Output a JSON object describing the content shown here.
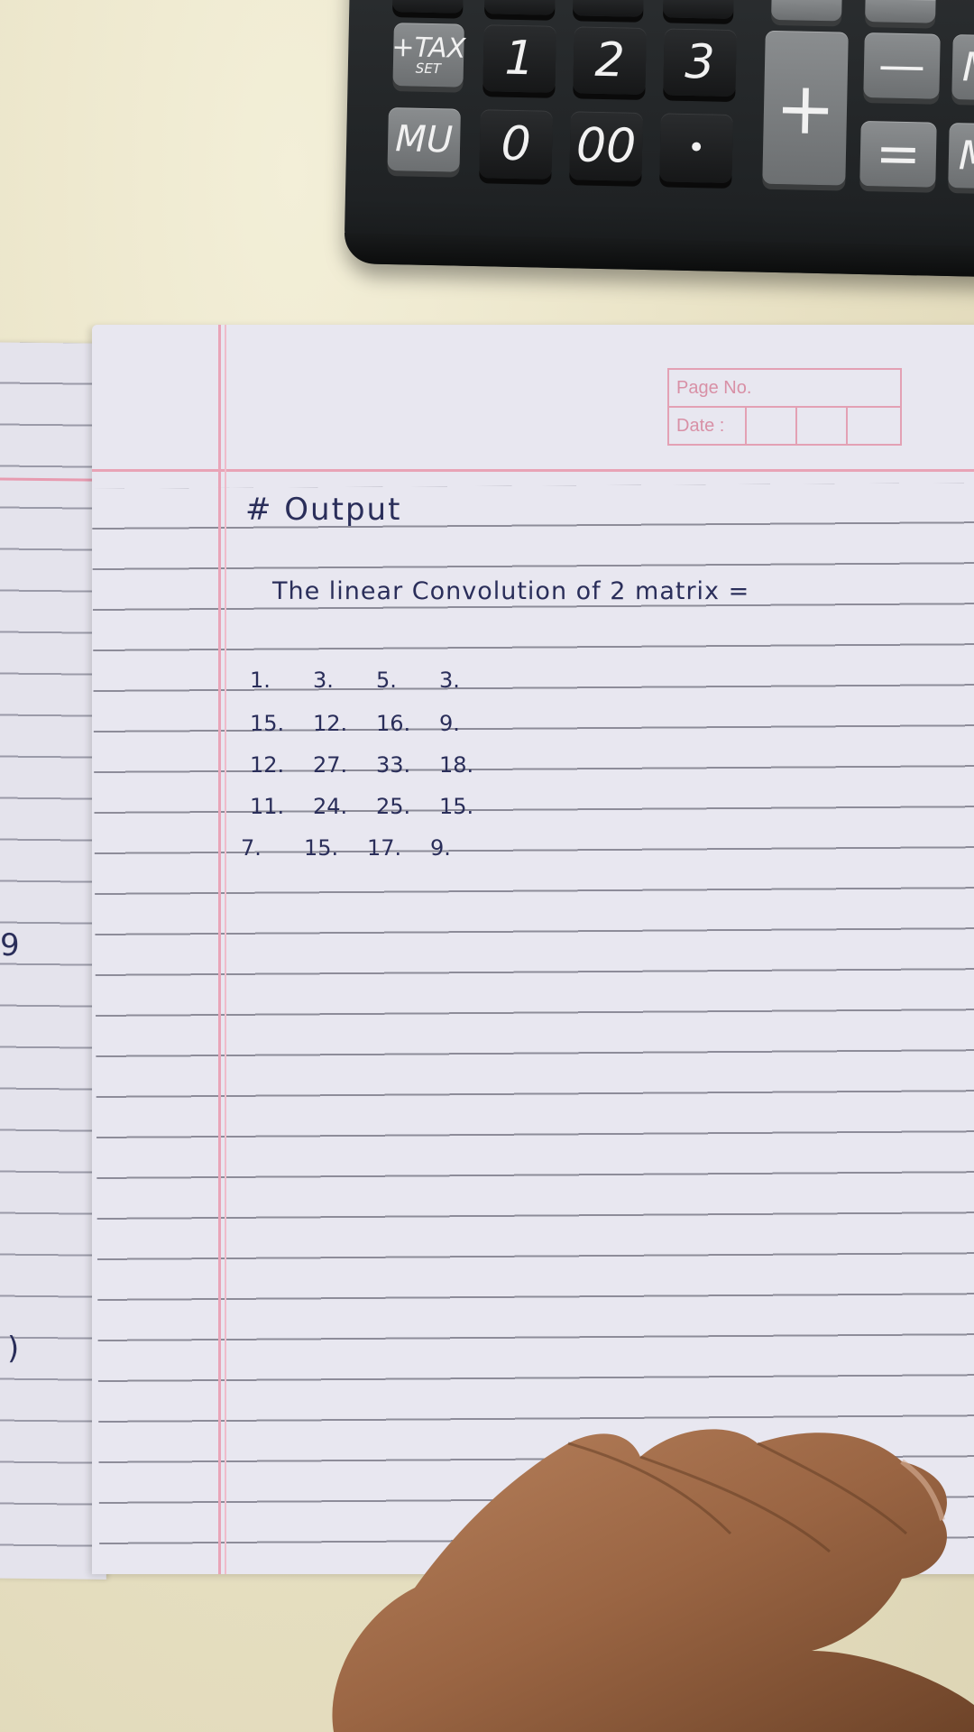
{
  "calculator": {
    "row1": [
      "+TAX",
      "1",
      "2",
      "3"
    ],
    "tax_sub": "SET",
    "row2": [
      "MU",
      "0",
      "00",
      "•"
    ],
    "plus": "+",
    "minus": "—",
    "equals": "=",
    "partial": [
      "M",
      "M"
    ]
  },
  "pagebox": {
    "page_no": "Page No.",
    "date": "Date :"
  },
  "notes": {
    "heading": "# Output",
    "sentence": "The linear Convolution of 2 matrix =",
    "matrix": [
      [
        "1.",
        "3.",
        "5.",
        "3."
      ],
      [
        "15.",
        "12.",
        "16.",
        "9."
      ],
      [
        "12.",
        "27.",
        "33.",
        "18."
      ],
      [
        "11.",
        "24.",
        "25.",
        "15."
      ],
      [
        "7.",
        "15.",
        "17.",
        "9."
      ]
    ]
  },
  "left_page_marks": [
    "9",
    ")"
  ]
}
